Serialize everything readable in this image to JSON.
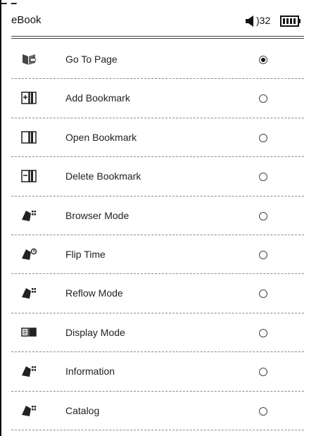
{
  "header": {
    "app_title": "eBook",
    "volume": ")32",
    "icons": [
      "speaker-icon",
      "battery-icon"
    ]
  },
  "menu": {
    "items": [
      {
        "label": "Go To Page",
        "icon": "go-to-page-icon",
        "selected": true
      },
      {
        "label": "Add Bookmark",
        "icon": "add-bookmark-icon",
        "selected": false
      },
      {
        "label": "Open Bookmark",
        "icon": "open-bookmark-icon",
        "selected": false
      },
      {
        "label": "Delete Bookmark",
        "icon": "delete-bookmark-icon",
        "selected": false
      },
      {
        "label": "Browser Mode",
        "icon": "browser-mode-icon",
        "selected": false
      },
      {
        "label": "Flip Time",
        "icon": "flip-time-icon",
        "selected": false
      },
      {
        "label": "Reflow Mode",
        "icon": "reflow-mode-icon",
        "selected": false
      },
      {
        "label": "Display Mode",
        "icon": "display-mode-icon",
        "selected": false
      },
      {
        "label": "Information",
        "icon": "information-icon",
        "selected": false
      },
      {
        "label": "Catalog",
        "icon": "catalog-icon",
        "selected": false
      }
    ]
  }
}
